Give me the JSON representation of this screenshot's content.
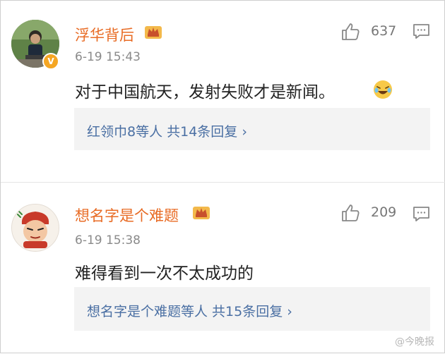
{
  "comments": [
    {
      "username": "浮华背后",
      "timestamp": "6-19 15:43",
      "content": "对于中国航天，发射失败才是新闻。",
      "likes": "637",
      "replies_summary": "红领巾8等人  共14条回复 ›",
      "verified": "V"
    },
    {
      "username": "想名字是个难题",
      "timestamp": "6-19 15:38",
      "content": "难得看到一次不太成功的",
      "likes": "209",
      "replies_summary": "想名字是个难题等人  共15条回复 ›"
    }
  ],
  "watermark": "@今晚报",
  "colors": {
    "username": "#e86b24",
    "link": "#4a6fa3",
    "badge": "#f5a623"
  },
  "icons": [
    "thumbs-up-icon",
    "comment-icon",
    "crown-icon",
    "laughing-emoji-icon",
    "verified-badge-icon"
  ]
}
